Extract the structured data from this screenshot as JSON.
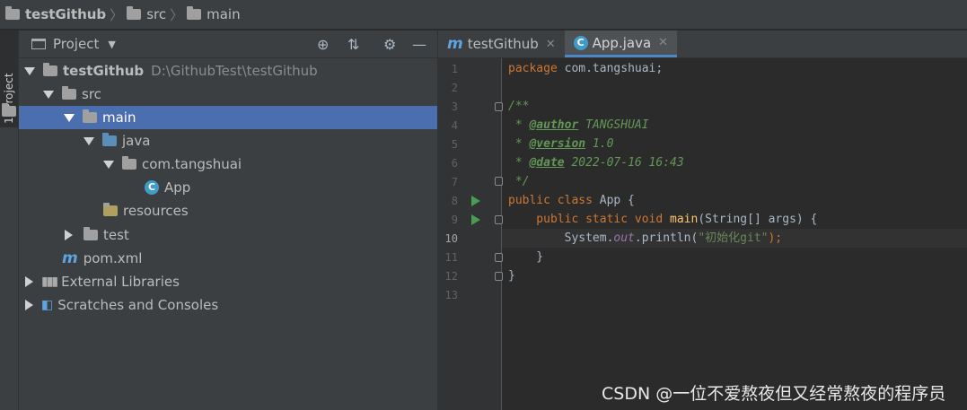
{
  "breadcrumb": {
    "project": "testGithub",
    "src": "src",
    "main": "main"
  },
  "sidebar_tab": {
    "label": "1: Project"
  },
  "panel": {
    "title": "Project"
  },
  "tree": [
    {
      "label": "testGithub",
      "extra": "D:\\GithubTest\\testGithub"
    },
    {
      "label": "src"
    },
    {
      "label": "main"
    },
    {
      "label": "java"
    },
    {
      "label": "com.tangshuai"
    },
    {
      "label": "App"
    },
    {
      "label": "resources"
    },
    {
      "label": "test"
    },
    {
      "label": "pom.xml"
    },
    {
      "label": "External Libraries"
    },
    {
      "label": "Scratches and Consoles"
    }
  ],
  "tabs": [
    {
      "label": "testGithub"
    },
    {
      "label": "App.java"
    }
  ],
  "code": {
    "l1a": "package",
    "l1b": " com.tangshuai;",
    "l3": "/**",
    "l4a": " * ",
    "l4tag": "@author",
    "l4b": " TANGSHUAI",
    "l5a": " * ",
    "l5tag": "@version",
    "l5b": " 1.0",
    "l6a": " * ",
    "l6tag": "@date",
    "l6b": " 2022-07-16 16:43",
    "l7": " */",
    "l8a": "public class",
    "l8b": " App {",
    "l9a": "    public static void",
    "l9b": " main",
    "l9c": "(String[] args) {",
    "l10a": "        System.",
    "l10b": "out",
    "l10c": ".println(",
    "l10d": "\"初始化git\"",
    "l10e": ");",
    "l11": "    }",
    "l12": "}"
  },
  "line_numbers": [
    "1",
    "2",
    "3",
    "4",
    "5",
    "6",
    "7",
    "8",
    "9",
    "10",
    "11",
    "12",
    "13"
  ],
  "current_line": "10",
  "watermark": "CSDN @一位不爱熬夜但又经常熬夜的程序员"
}
